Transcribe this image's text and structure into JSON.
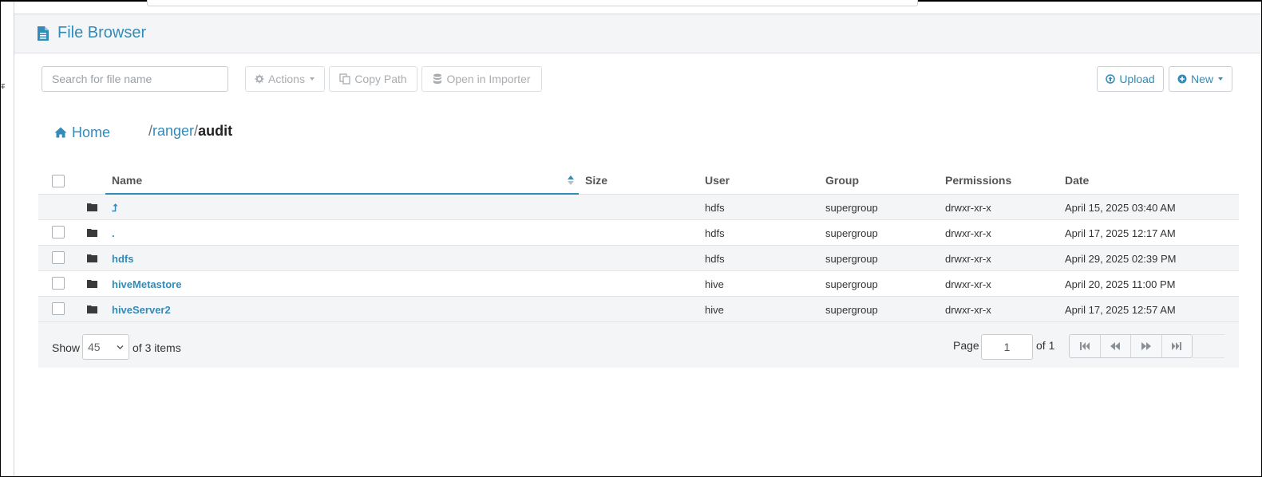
{
  "app": {
    "title": "File Browser",
    "icon": "file-text-icon",
    "accent_color": "#338bb8"
  },
  "toolbar": {
    "search_placeholder": "Search for file name",
    "actions_label": "Actions",
    "copy_path_label": "Copy Path",
    "open_importer_label": "Open in Importer",
    "upload_label": "Upload",
    "new_label": "New"
  },
  "breadcrumb": {
    "home_label": "Home",
    "separator": "/",
    "parent": "ranger",
    "current": "audit"
  },
  "table": {
    "headers": {
      "name": "Name",
      "size": "Size",
      "user": "User",
      "group": "Group",
      "permissions": "Permissions",
      "date": "Date"
    },
    "rows": [
      {
        "name": "⮥",
        "size": "",
        "user": "hdfs",
        "group": "supergroup",
        "permissions": "drwxr-xr-x",
        "date": "April 15, 2025 03:40 AM"
      },
      {
        "name": ".",
        "size": "",
        "user": "hdfs",
        "group": "supergroup",
        "permissions": "drwxr-xr-x",
        "date": "April 17, 2025 12:17 AM"
      },
      {
        "name": "hdfs",
        "size": "",
        "user": "hdfs",
        "group": "supergroup",
        "permissions": "drwxr-xr-x",
        "date": "April 29, 2025 02:39 PM"
      },
      {
        "name": "hiveMetastore",
        "size": "",
        "user": "hive",
        "group": "supergroup",
        "permissions": "drwxr-xr-x",
        "date": "April 20, 2025 11:00 PM"
      },
      {
        "name": "hiveServer2",
        "size": "",
        "user": "hive",
        "group": "supergroup",
        "permissions": "drwxr-xr-x",
        "date": "April 17, 2025 12:57 AM"
      }
    ]
  },
  "footer": {
    "show_label": "Show",
    "page_size": "45",
    "items_label": "of 3 items",
    "page_label": "Page",
    "page_value": "1",
    "page_total": "of 1"
  }
}
